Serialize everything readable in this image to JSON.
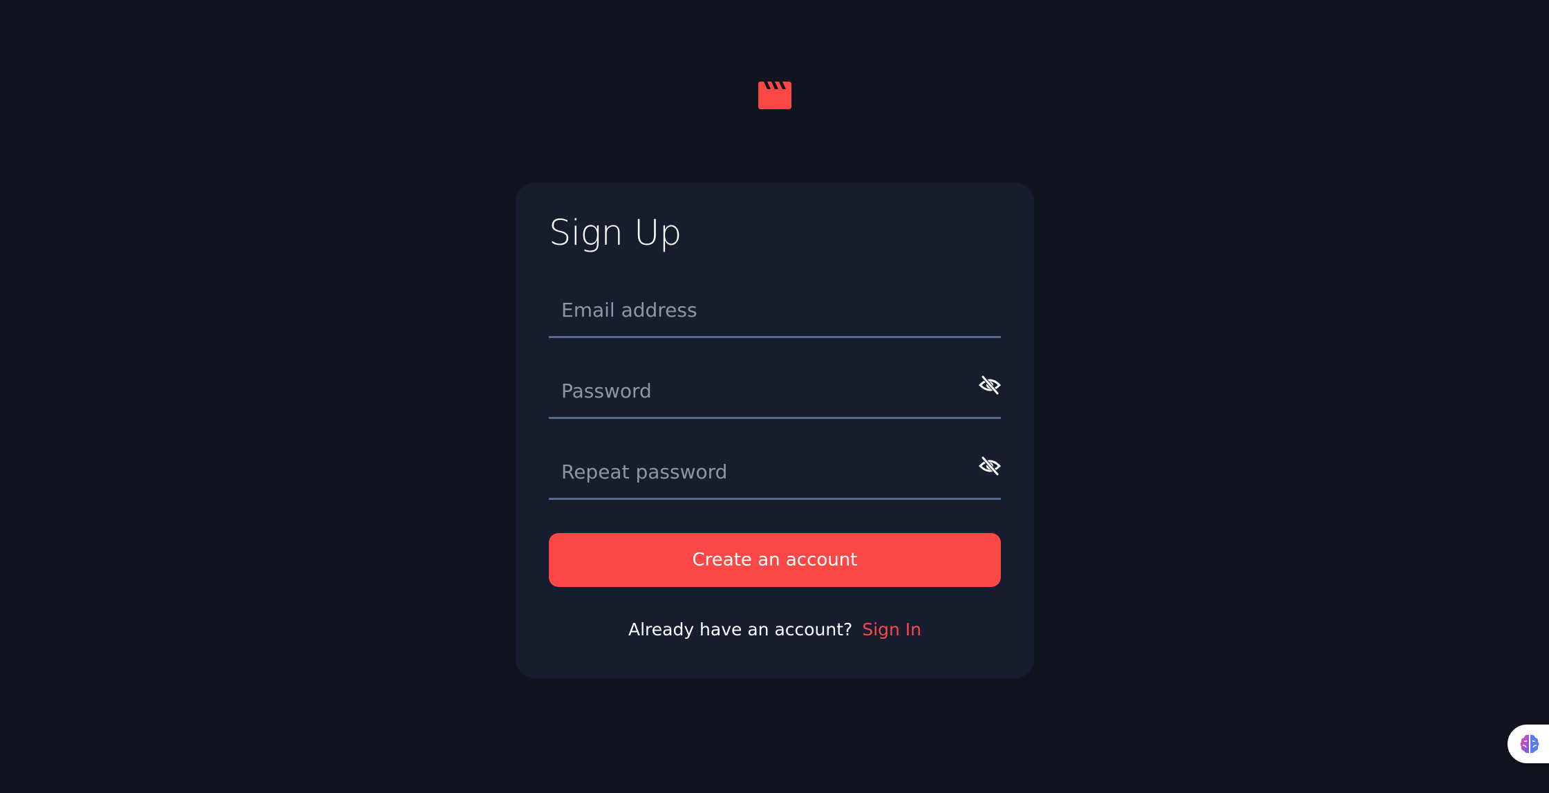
{
  "colors": {
    "background": "#10141E",
    "card": "#161D2F",
    "accent": "#FC4747",
    "input_line": "#5A698F",
    "placeholder": "#8E95A7",
    "text": "#FFFFFF"
  },
  "logo": {
    "icon": "movie-clapper-icon"
  },
  "form": {
    "title": "Sign Up",
    "email": {
      "placeholder": "Email address",
      "value": ""
    },
    "password": {
      "placeholder": "Password",
      "value": "",
      "toggle_icon": "eye-slash-icon"
    },
    "repeat_password": {
      "placeholder": "Repeat password",
      "value": "",
      "toggle_icon": "eye-slash-icon"
    },
    "submit_label": "Create an account",
    "footer_text": "Already have an account?",
    "footer_link": "Sign In"
  },
  "extension_widget": {
    "icon": "brain-icon"
  }
}
